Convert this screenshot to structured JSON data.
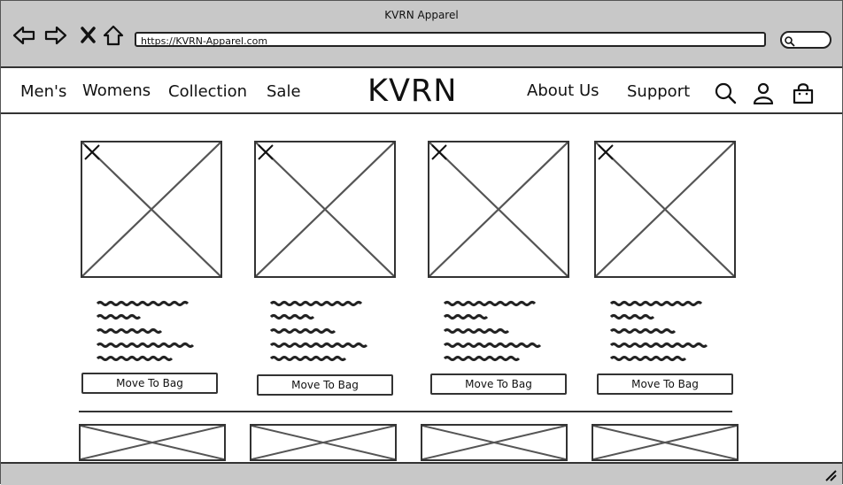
{
  "window": {
    "title": "KVRN Apparel"
  },
  "browser": {
    "url": "https://KVRN-Apparel.com",
    "icons": [
      "back-arrow-icon",
      "forward-arrow-icon",
      "close-icon",
      "home-icon",
      "search-icon"
    ]
  },
  "nav": {
    "left_links": [
      "Men's",
      "Womens",
      "Collection",
      "Sale"
    ],
    "brand": "KVRN",
    "right_links": [
      "About Us",
      "Support"
    ],
    "icons": [
      "search-icon",
      "user-icon",
      "bag-icon"
    ]
  },
  "products": [
    {
      "button_label": "Move To Bag"
    },
    {
      "button_label": "Move To Bag"
    },
    {
      "button_label": "Move To Bag"
    },
    {
      "button_label": "Move To Bag"
    }
  ]
}
